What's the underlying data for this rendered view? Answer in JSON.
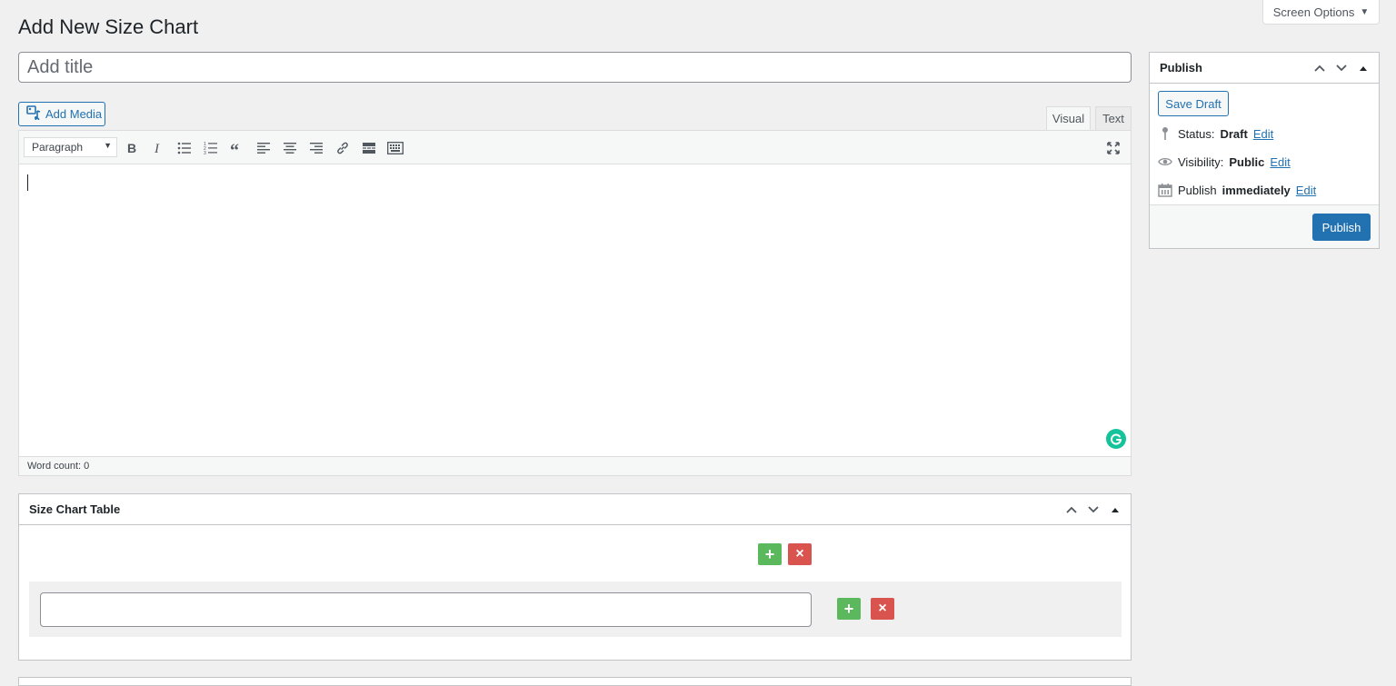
{
  "screen_options": {
    "label": "Screen Options",
    "arrow": "▼"
  },
  "page_title": "Add New Size Chart",
  "title_input": {
    "placeholder": "Add title",
    "value": ""
  },
  "media": {
    "add_media_label": "Add Media"
  },
  "editor": {
    "tabs": [
      {
        "label": "Visual",
        "active": true
      },
      {
        "label": "Text",
        "active": false
      }
    ],
    "format_select": {
      "value": "Paragraph"
    },
    "toolbar_buttons": [
      "bold",
      "italic",
      "bulleted-list",
      "numbered-list",
      "blockquote",
      "align-left",
      "align-center",
      "align-right",
      "insert-link",
      "read-more",
      "toolbar-toggle",
      "fullscreen"
    ],
    "word_count": "Word count: 0"
  },
  "publish": {
    "title": "Publish",
    "save_draft_label": "Save Draft",
    "status": {
      "label": "Status:",
      "value": "Draft",
      "edit": "Edit"
    },
    "visibility": {
      "label": "Visibility:",
      "value": "Public",
      "edit": "Edit"
    },
    "schedule": {
      "label": "Publish",
      "value": "immediately",
      "edit": "Edit"
    },
    "publish_label": "Publish"
  },
  "size_chart": {
    "title": "Size Chart Table",
    "add_symbol": "+",
    "remove_symbol": "×",
    "row_value": ""
  },
  "colors": {
    "accent": "#2271b1",
    "add_green": "#5cb85c",
    "remove_red": "#d9534f",
    "grammarly": "#15c39a"
  }
}
